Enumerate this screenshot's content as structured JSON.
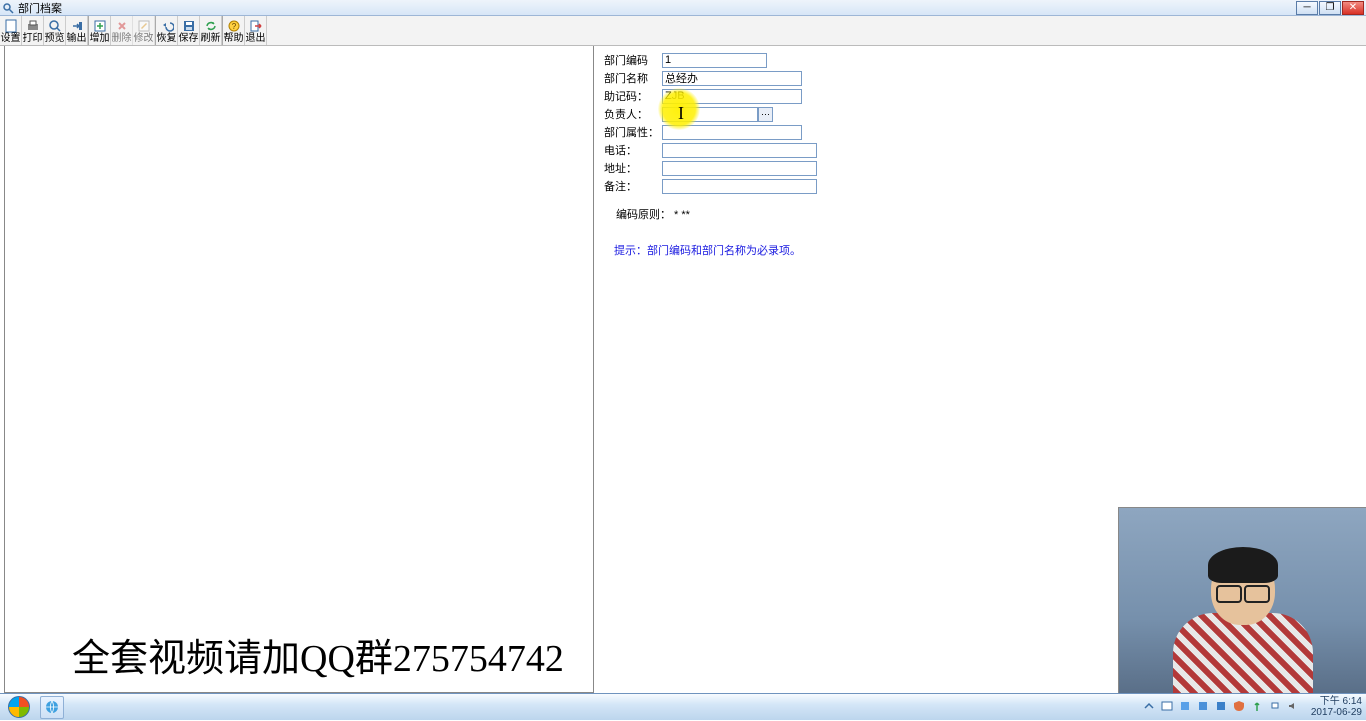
{
  "window": {
    "title": "部门档案"
  },
  "toolbar": {
    "items": [
      {
        "label": "设置",
        "icon": "page"
      },
      {
        "label": "打印",
        "icon": "printer"
      },
      {
        "label": "预览",
        "icon": "zoom"
      },
      {
        "label": "输出",
        "icon": "export"
      },
      {
        "label": "增加",
        "icon": "add"
      },
      {
        "label": "删除",
        "icon": "delete",
        "disabled": true
      },
      {
        "label": "修改",
        "icon": "edit",
        "disabled": true
      },
      {
        "label": "恢复",
        "icon": "undo"
      },
      {
        "label": "保存",
        "icon": "save"
      },
      {
        "label": "刷新",
        "icon": "refresh"
      },
      {
        "label": "帮助",
        "icon": "help"
      },
      {
        "label": "退出",
        "icon": "exit"
      }
    ]
  },
  "form": {
    "dept_code": {
      "label": "部门编码",
      "value": "1"
    },
    "dept_name": {
      "label": "部门名称",
      "value": "总经办"
    },
    "mnemonic": {
      "label": "助记码：",
      "value": "ZJB"
    },
    "manager": {
      "label": "负责人：",
      "value": ""
    },
    "attribute": {
      "label": "部门属性：",
      "value": ""
    },
    "phone": {
      "label": "电话：",
      "value": ""
    },
    "address": {
      "label": "地址：",
      "value": ""
    },
    "remark": {
      "label": "备注：",
      "value": ""
    }
  },
  "rule": "编码原则： * **",
  "hint": "提示：部门编码和部门名称为必录项。",
  "watermark": "全套视频请加QQ群275754742",
  "taskbar": {
    "time": "下午 6:14",
    "date": "2017-06-29"
  }
}
